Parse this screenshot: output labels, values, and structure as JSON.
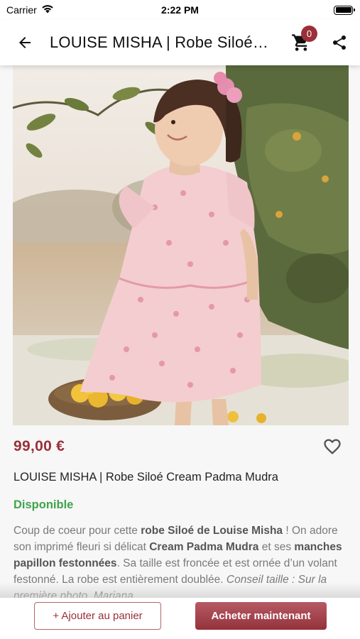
{
  "status_bar": {
    "carrier": "Carrier",
    "time": "2:22 PM",
    "icons": [
      "wifi-icon",
      "battery-icon"
    ]
  },
  "header": {
    "title": "LOUISE MISHA | Robe Siloé Cream Padma Mudra",
    "cart_count": "0",
    "icons": [
      "arrow-left-icon",
      "cart-icon",
      "share-icon"
    ]
  },
  "product": {
    "price": "99,00 €",
    "name": "LOUISE MISHA | Robe Siloé Cream Padma Mudra",
    "availability": "Disponible",
    "description": {
      "s1": "Coup de coeur pour cette ",
      "b1": "robe Siloé de Louise Misha",
      "s2": " ! On adore son imprimé fleuri si délicat ",
      "b2": "Cream Padma Mudra",
      "s3": " et ses ",
      "b3": "manches papillon festonnées",
      "s4": ". Sa taille est froncée et est ornée d’un volant festonné. La robe est entièrement doublée. ",
      "i1": "Conseil taille : Sur la première photo, Mariana"
    }
  },
  "actions": {
    "add_to_cart": "+ Ajouter au panier",
    "buy_now": "Acheter maintenant"
  },
  "colors": {
    "brand": "#9a3039",
    "available": "#3fa34d",
    "text_muted": "#7a7a7a"
  }
}
